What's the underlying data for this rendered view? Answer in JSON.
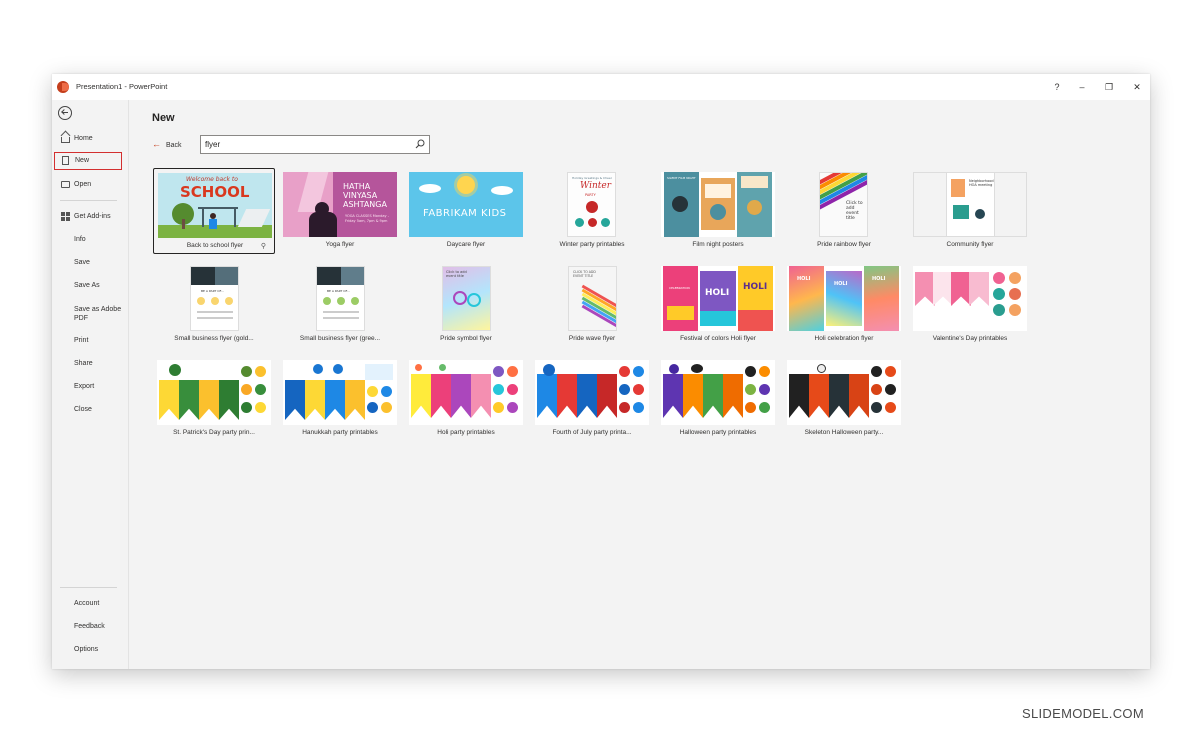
{
  "window": {
    "title": "Presentation1 - PowerPoint",
    "controls": {
      "help": "?",
      "minimize": "–",
      "restore": "❐",
      "close": "✕"
    }
  },
  "sidebar": {
    "items": [
      {
        "label": "Home",
        "icon": "home-icon"
      },
      {
        "label": "New",
        "icon": "new-document-icon",
        "selected": true
      },
      {
        "label": "Open",
        "icon": "folder-open-icon"
      },
      {
        "label": "Get Add-ins",
        "icon": "add-ins-grid-icon"
      },
      {
        "label": "Info"
      },
      {
        "label": "Save"
      },
      {
        "label": "Save As"
      },
      {
        "label": "Save as Adobe PDF"
      },
      {
        "label": "Print"
      },
      {
        "label": "Share"
      },
      {
        "label": "Export"
      },
      {
        "label": "Close"
      }
    ],
    "bottom_items": [
      {
        "label": "Account"
      },
      {
        "label": "Feedback"
      },
      {
        "label": "Options"
      }
    ]
  },
  "main": {
    "page_title": "New",
    "back_label": "Back",
    "search": {
      "value": "flyer",
      "icon": "search-icon"
    }
  },
  "templates": [
    {
      "name": "Back to school flyer",
      "headline": "SCHOOL",
      "tagline": "Welcome back to",
      "selected": true
    },
    {
      "name": "Yoga flyer",
      "headline": "HATHA VINYASA ASHTANGA",
      "detail": "YOGA CLASSES Monday - Friday 5am, 7pm & 9pm"
    },
    {
      "name": "Daycare flyer",
      "headline": "FABRIKAM KIDS"
    },
    {
      "name": "Winter party printables",
      "headline": "Winter",
      "tagline": "Holiday Greetings & Cheer",
      "detail": "PARTY"
    },
    {
      "name": "Film night posters",
      "headline": "SILENT FILM NIGHT"
    },
    {
      "name": "Pride rainbow flyer",
      "headline": "Click to add event title"
    },
    {
      "name": "Community flyer",
      "headline": "Neighborhood HOA meeting"
    },
    {
      "name": "Small business flyer (gold...",
      "headline": "BE A PART OF..."
    },
    {
      "name": "Small business flyer (gree...",
      "headline": "BE A PART OF..."
    },
    {
      "name": "Pride symbol flyer",
      "headline": "Click to add event title"
    },
    {
      "name": "Pride wave flyer",
      "headline": "CLICK TO ADD EVENT TITLE"
    },
    {
      "name": "Festival of colors Holi flyer",
      "headline": "HOLI",
      "tagline": "CELEBRATION"
    },
    {
      "name": "Holi celebration flyer",
      "headline": "HOLI"
    },
    {
      "name": "Valentine's Day printables"
    },
    {
      "name": "St. Patrick's Day party prin..."
    },
    {
      "name": "Hanukkah party printables"
    },
    {
      "name": "Holi party printables"
    },
    {
      "name": "Fourth of July party printa..."
    },
    {
      "name": "Halloween party printables"
    },
    {
      "name": "Skeleton Halloween party..."
    }
  ],
  "colors": {
    "accent": "#c43e1c",
    "selected_outline": "#d32f2f",
    "window_bg": "#f3f3f3"
  },
  "watermark": "SLIDEMODEL.COM"
}
